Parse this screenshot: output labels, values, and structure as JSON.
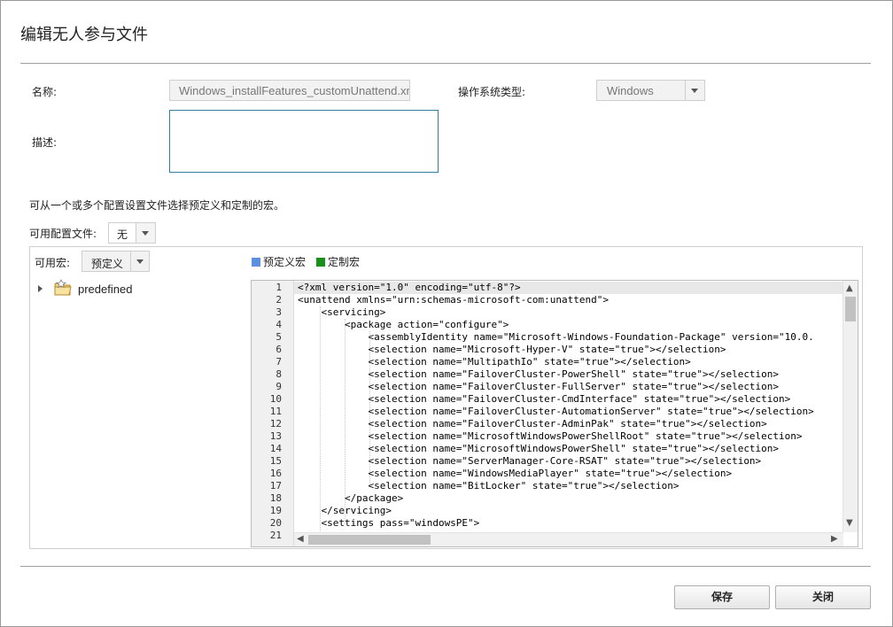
{
  "dialog": {
    "title": "编辑无人参与文件"
  },
  "form": {
    "name_label": "名称:",
    "name_value": "Windows_installFeatures_customUnattend.xml",
    "os_label": "操作系统类型:",
    "os_value": "Windows",
    "desc_label": "描述:",
    "desc_value": "",
    "hint": "可从一个或多个配置设置文件选择预定义和定制的宏。",
    "profile_label": "可用配置文件:",
    "profile_value": "无"
  },
  "macros": {
    "label": "可用宏:",
    "select_value": "预定义",
    "tree_item": "predefined",
    "legend_predefined": "预定义宏",
    "legend_custom": "定制宏",
    "predefined_color": "#5b8fe0",
    "custom_color": "#1a8f1a"
  },
  "editor": {
    "current_line": 1,
    "lines": [
      {
        "n": "1",
        "t": "<?xml version=\"1.0\" encoding=\"utf-8\"?>"
      },
      {
        "n": "2",
        "t": "<unattend xmlns=\"urn:schemas-microsoft-com:unattend\">"
      },
      {
        "n": "3",
        "t": "    <servicing>"
      },
      {
        "n": "4",
        "t": "        <package action=\"configure\">"
      },
      {
        "n": "5",
        "t": "            <assemblyIdentity name=\"Microsoft-Windows-Foundation-Package\" version=\"10.0."
      },
      {
        "n": "6",
        "t": "            <selection name=\"Microsoft-Hyper-V\" state=\"true\"></selection>"
      },
      {
        "n": "7",
        "t": "            <selection name=\"MultipathIo\" state=\"true\"></selection>"
      },
      {
        "n": "8",
        "t": "            <selection name=\"FailoverCluster-PowerShell\" state=\"true\"></selection>"
      },
      {
        "n": "9",
        "t": "            <selection name=\"FailoverCluster-FullServer\" state=\"true\"></selection>"
      },
      {
        "n": "10",
        "t": "            <selection name=\"FailoverCluster-CmdInterface\" state=\"true\"></selection>"
      },
      {
        "n": "11",
        "t": "            <selection name=\"FailoverCluster-AutomationServer\" state=\"true\"></selection>"
      },
      {
        "n": "12",
        "t": "            <selection name=\"FailoverCluster-AdminPak\" state=\"true\"></selection>"
      },
      {
        "n": "13",
        "t": "            <selection name=\"MicrosoftWindowsPowerShellRoot\" state=\"true\"></selection>"
      },
      {
        "n": "14",
        "t": "            <selection name=\"MicrosoftWindowsPowerShell\" state=\"true\"></selection>"
      },
      {
        "n": "15",
        "t": "            <selection name=\"ServerManager-Core-RSAT\" state=\"true\"></selection>"
      },
      {
        "n": "16",
        "t": "            <selection name=\"WindowsMediaPlayer\" state=\"true\"></selection>"
      },
      {
        "n": "17",
        "t": "            <selection name=\"BitLocker\" state=\"true\"></selection>"
      },
      {
        "n": "18",
        "t": "        </package>"
      },
      {
        "n": "19",
        "t": "    </servicing>"
      },
      {
        "n": "20",
        "t": "    <settings pass=\"windowsPE\">"
      },
      {
        "n": "21",
        "t": ""
      }
    ]
  },
  "buttons": {
    "save": "保存",
    "close": "关闭"
  }
}
